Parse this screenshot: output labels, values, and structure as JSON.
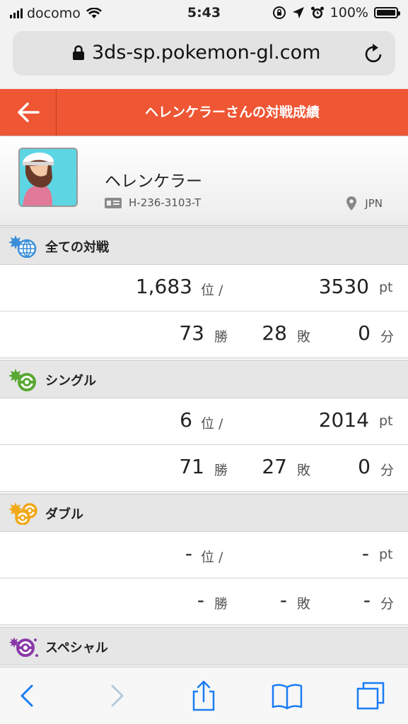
{
  "status_bar": {
    "carrier": "docomo",
    "time": "5:43",
    "battery": "100%"
  },
  "browser": {
    "url": "3ds-sp.pokemon-gl.com"
  },
  "header": {
    "title": "ヘレンケラーさんの対戦成績"
  },
  "profile": {
    "name": "ヘレンケラー",
    "id": "H-236-3103-T",
    "region": "JPN"
  },
  "sections": [
    {
      "label": "全ての対戦",
      "icon": "globe-battle-icon",
      "color": "#3a8fd8",
      "rank": "1,683",
      "rank_unit": "位 /",
      "points": "3530",
      "points_unit": "pt",
      "wins": "73",
      "wins_unit": "勝",
      "losses": "28",
      "losses_unit": "敗",
      "draws": "0",
      "draws_unit": "分"
    },
    {
      "label": "シングル",
      "icon": "single-battle-icon",
      "color": "#5aa832",
      "rank": "6",
      "rank_unit": "位 /",
      "points": "2014",
      "points_unit": "pt",
      "wins": "71",
      "wins_unit": "勝",
      "losses": "27",
      "losses_unit": "敗",
      "draws": "0",
      "draws_unit": "分"
    },
    {
      "label": "ダブル",
      "icon": "double-battle-icon",
      "color": "#f0a818",
      "rank": "-",
      "rank_unit": "位 /",
      "points": "-",
      "points_unit": "pt",
      "wins": "-",
      "wins_unit": "勝",
      "losses": "-",
      "losses_unit": "敗",
      "draws": "-",
      "draws_unit": "分"
    },
    {
      "label": "スペシャル",
      "icon": "special-battle-icon",
      "color": "#8a3aa8"
    }
  ],
  "colors": {
    "header": "#ee5634",
    "toolbar_icon": "#1a7cf5"
  }
}
